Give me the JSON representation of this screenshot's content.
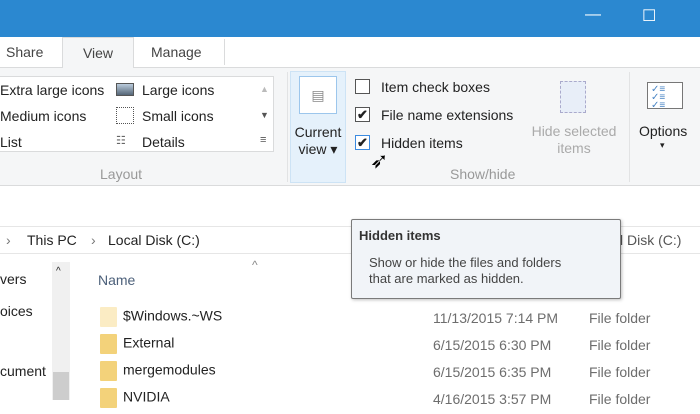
{
  "window": {
    "minimize": "—",
    "maximize": "☐"
  },
  "tabs": [
    {
      "label": "Share"
    },
    {
      "label": "View"
    },
    {
      "label": "Manage"
    }
  ],
  "layout": {
    "items": [
      "Extra large icons",
      "Large icons",
      "Medium icons",
      "Small icons",
      "List",
      "Details"
    ],
    "group": "Layout"
  },
  "current_view": {
    "line1": "Current",
    "line2": "view ▾"
  },
  "showhide": {
    "items": [
      {
        "label": "Item check boxes",
        "checked": false
      },
      {
        "label": "File name extensions",
        "checked": true
      },
      {
        "label": "Hidden items",
        "checked": true
      }
    ],
    "hide_selected_1": "Hide selected",
    "hide_selected_2": "items",
    "group": "Show/hide"
  },
  "options": {
    "label": "Options",
    "arrow": "▾"
  },
  "address": {
    "crumbs": [
      "This PC",
      "Local Disk (C:)"
    ],
    "search_tail": "l Disk (C:)"
  },
  "nav": [
    "vers",
    "oices",
    "cument"
  ],
  "columns": {
    "name": "Name"
  },
  "files": [
    {
      "name": "$Windows.~WS",
      "date": "11/13/2015 7:14 PM",
      "type": "File folder"
    },
    {
      "name": "External",
      "date": "6/15/2015 6:30 PM",
      "type": "File folder"
    },
    {
      "name": "mergemodules",
      "date": "6/15/2015 6:35 PM",
      "type": "File folder"
    },
    {
      "name": "NVIDIA",
      "date": "4/16/2015 3:57 PM",
      "type": "File folder"
    }
  ],
  "tooltip": {
    "title": "Hidden items",
    "body1": "Show or hide the files and folders",
    "body2": "that are marked as hidden."
  }
}
